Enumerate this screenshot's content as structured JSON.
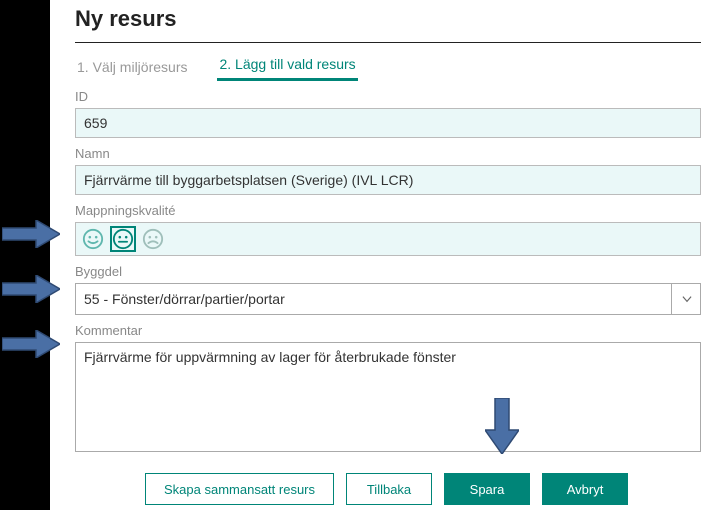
{
  "page_title": "Ny resurs",
  "tabs": {
    "tab1": "1. Välj miljöresurs",
    "tab2": "2. Lägg till vald resurs"
  },
  "labels": {
    "id": "ID",
    "name": "Namn",
    "quality": "Mappningskvalité",
    "byggdel": "Byggdel",
    "comment": "Kommentar"
  },
  "fields": {
    "id": "659",
    "name": "Fjärrvärme till byggarbetsplatsen (Sverige) (IVL LCR)",
    "byggdel": "55 - Fönster/dörrar/partier/portar",
    "comment": "Fjärrvärme för uppvärmning av lager för återbrukade fönster"
  },
  "buttons": {
    "compose": "Skapa sammansatt resurs",
    "back": "Tillbaka",
    "save": "Spara",
    "cancel": "Avbryt"
  },
  "colors": {
    "accent": "#008578",
    "arrow_fill": "#4A6FA5",
    "arrow_stroke": "#2F4A73"
  }
}
